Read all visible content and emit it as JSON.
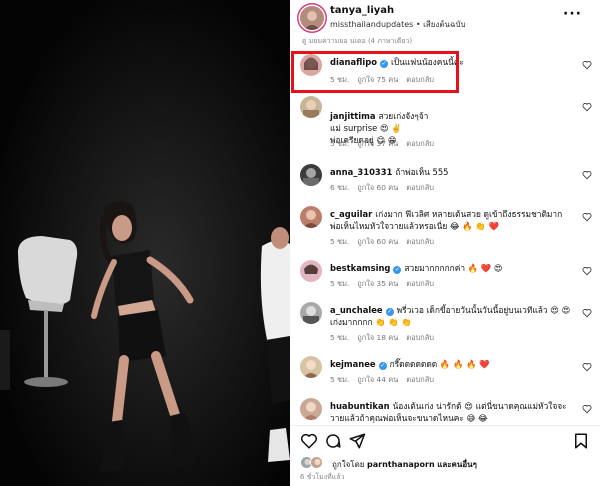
{
  "post": {
    "username": "tanya_liyah",
    "subtitle": "missthailandupdates • เสียงต้นฉบับ",
    "more_icon": "more-dots-icon",
    "truncated_text": "ตู่ มยมความยอ นเดอ (4 ภาษาเดียว)"
  },
  "comments": [
    {
      "username": "dianaflipo",
      "verified": true,
      "text": "เป็นแฟนน้องคนนี้ค่ะ",
      "time": "5 ชม.",
      "likes": "ถูกใจ 75 คน",
      "reply": "ตอบกลับ"
    },
    {
      "username": "janjittima",
      "verified": false,
      "text": "สวยเก่งจังๆจ้า\nแม่ surprise 😍 ✌️\nพ่อเครียดอยู่ 😋 😁",
      "time": "5 ชม.",
      "likes": "ถูกใจ 37 คน",
      "reply": "ตอบกลับ"
    },
    {
      "username": "anna_310331",
      "verified": false,
      "text": "ถ้าพ่อเห็น 555",
      "time": "6 ชม.",
      "likes": "ถูกใจ 60 คน",
      "reply": "ตอบกลับ"
    },
    {
      "username": "c_aguilar",
      "verified": false,
      "text": "เก่งมาก ฟีเวลิศ หลายเต้นสวย ดูเข้าถึงธรรมชาติมาก พ่อเห็นไหมหัวใจวายแล้วหรอเนี่ย 😂 🔥 👏 ❤️",
      "time": "5 ชม.",
      "likes": "ถูกใจ 60 คน",
      "reply": "ตอบกลับ"
    },
    {
      "username": "bestkamsing",
      "verified": true,
      "text": "สวยมากกกกกค่า 🔥 ❤️ 😍",
      "time": "5 ชม.",
      "likes": "ถูกใจ 35 คน",
      "reply": "ตอบกลับ"
    },
    {
      "username": "a_unchalee",
      "verified": true,
      "text": "พรี่วเวอ เด็กขี้อายวันนั้นวันนี้อยู่บนเวทีแล้ว 😍 😍 เก่งมากกกก 👏 👏 👏",
      "time": "5 ชม.",
      "likes": "ถูกใจ 18 คน",
      "reply": "ตอบกลับ"
    },
    {
      "username": "kejmanee",
      "verified": true,
      "text": "กรี๊ดดดดดดด 🔥 🔥 🔥 ❤️",
      "time": "5 ชม.",
      "likes": "ถูกใจ 44 คน",
      "reply": "ตอบกลับ"
    },
    {
      "username": "huabuntikan",
      "verified": false,
      "text": "น้องเต้นเก่ง น่ารักด้ 😍 แต่นี่ขนาดคุณแม่หัวใจจะวายแล้วถ้าคุณพ่อเห็นจะขนาดไหนคะ 😅 😂",
      "time": "",
      "likes": "",
      "reply": ""
    }
  ],
  "actions": {
    "like_icon": "heart-outline-icon",
    "comment_icon": "comment-icon",
    "share_icon": "share-icon",
    "save_icon": "bookmark-icon"
  },
  "liked_by": {
    "prefix": "ถูกใจโดย",
    "user": "parnthanaporn",
    "suffix": "และคนอื่นๆ"
  },
  "posted_time": "6 ชั่วโมงที่แล้ว",
  "colors": {
    "highlight_border": "#e5121b",
    "verified_badge": "#3897f0",
    "story_ring": "#d63d7a"
  }
}
